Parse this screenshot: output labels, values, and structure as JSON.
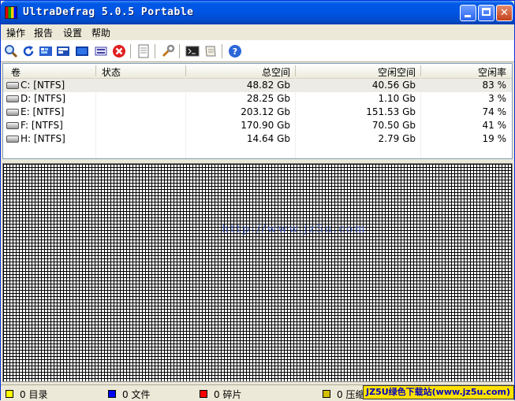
{
  "window": {
    "title": "UltraDefrag 5.0.5 Portable"
  },
  "menu": [
    "操作",
    "报告",
    "设置",
    "帮助"
  ],
  "toolbar": {
    "icons": [
      "search-icon",
      "refresh-icon",
      "defrag-icon",
      "quick-optimize-icon",
      "full-optimize-icon",
      "mft-optimize-icon",
      "stop-icon",
      "report-icon",
      "settings-icon",
      "boot-time-script-icon",
      "script-editor-icon",
      "help-icon"
    ]
  },
  "volumes": {
    "columns": [
      "卷",
      "状态",
      "总空间",
      "空闲空间",
      "空闲率"
    ],
    "rows": [
      {
        "volume": "C: [NTFS]",
        "status": "",
        "total": "48.82 Gb",
        "free": "40.56 Gb",
        "percent": "83 %"
      },
      {
        "volume": "D: [NTFS]",
        "status": "",
        "total": "28.25 Gb",
        "free": "1.10 Gb",
        "percent": "3 %"
      },
      {
        "volume": "E: [NTFS]",
        "status": "",
        "total": "203.12 Gb",
        "free": "151.53 Gb",
        "percent": "74 %"
      },
      {
        "volume": "F: [NTFS]",
        "status": "",
        "total": "170.90 Gb",
        "free": "70.50 Gb",
        "percent": "41 %"
      },
      {
        "volume": "H: [NTFS]",
        "status": "",
        "total": "14.64 Gb",
        "free": "2.79 Gb",
        "percent": "19 %"
      }
    ]
  },
  "clustermap": {
    "watermark": "http://www.jz5u.com"
  },
  "statusbar": {
    "items": [
      {
        "count": "0",
        "label": "目录",
        "color": "#ffff00"
      },
      {
        "count": "0",
        "label": "文件",
        "color": "#0000ff"
      },
      {
        "count": "0",
        "label": "碎片",
        "color": "#ff0000"
      },
      {
        "count": "0",
        "label": "压缩",
        "color": "#d4c000"
      }
    ],
    "banner": "JZ5U绿色下载站(www.jz5u.com)"
  }
}
